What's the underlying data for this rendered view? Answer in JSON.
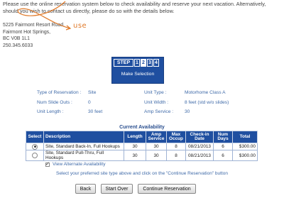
{
  "intro_text": "Please use the online reservation system below to check availability and reserve your next vacation. Alternatively, should you wish to contact us directly, please do so with the details below.",
  "address": [
    "5225 Fairmont Resort Road,",
    "Fairmont Hot Springs,",
    "BC V0B 1L1",
    "250.345.6033"
  ],
  "annotation": {
    "label": "use",
    "color": "#e07a2a"
  },
  "steps": {
    "word": "STEP",
    "numbers": [
      "1",
      "2",
      "3",
      "4"
    ],
    "active": "2",
    "caption": "Make Selection"
  },
  "details": {
    "left": [
      {
        "label": "Type of Reservation :",
        "value": "Site"
      },
      {
        "label": "Num Slide Outs :",
        "value": "0"
      },
      {
        "label": "Unit Length :",
        "value": "30 feet"
      }
    ],
    "right": [
      {
        "label": "Unit Type :",
        "value": "Motorhome Class A"
      },
      {
        "label": "Unit Width :",
        "value": "8 feet (std w/o slides)"
      },
      {
        "label": "Amp Service :",
        "value": "30"
      }
    ]
  },
  "availability": {
    "title": "Current Availability",
    "columns": [
      "Select",
      "Description",
      "Length",
      "Amp Service",
      "Max Occup",
      "Check-in Date",
      "Num Days",
      "Total"
    ],
    "rows": [
      {
        "selected": true,
        "description": "Site, Standard Back-In, Full Hookups",
        "length": "30",
        "amp": "30",
        "max": "8",
        "checkin": "08/21/2013",
        "days": "6",
        "total": "$300.00"
      },
      {
        "selected": false,
        "description": "Site, Standard Pull-Thru, Full Hookups",
        "length": "30",
        "amp": "30",
        "max": "8",
        "checkin": "08/21/2013",
        "days": "6",
        "total": "$300.00"
      }
    ]
  },
  "view_alternate": "View Alternate Availability",
  "hint": "Select your preferred site type above and click on the \"Continue Reservation\" button",
  "buttons": {
    "back": "Back",
    "start_over": "Start Over",
    "continue": "Continue Reservation"
  },
  "colors": {
    "header_blue": "#1f4fa0",
    "label_blue": "#3f6aa8"
  }
}
